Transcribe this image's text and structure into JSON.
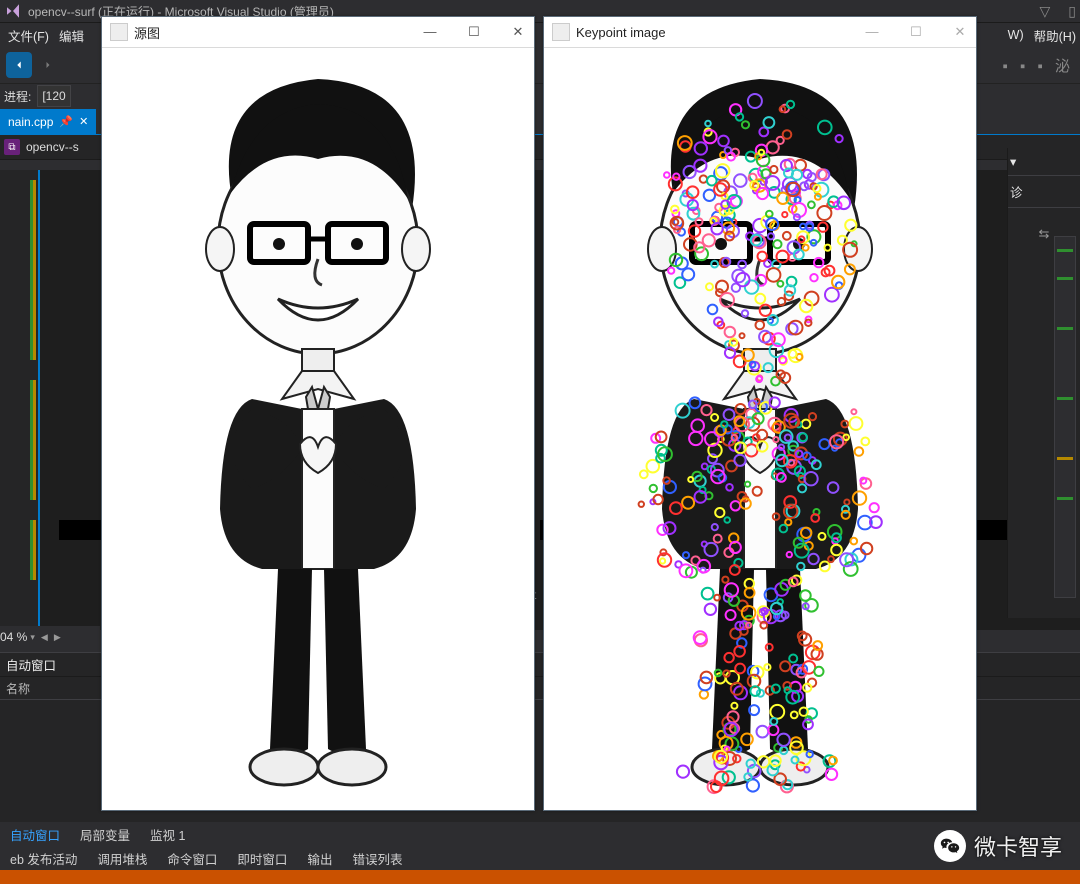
{
  "titlebar": {
    "text": "opencv--surf (正在运行) - Microsoft Visual Studio (管理员)"
  },
  "menus": {
    "file": "文件(F)",
    "edit": "编辑",
    "help": "帮助(H)",
    "w_hotkey": "W)"
  },
  "process": {
    "label": "进程:",
    "value": "[120"
  },
  "tab": {
    "filename": "nain.cpp"
  },
  "solution_item": "opencv--s",
  "right_panel": {
    "tab_diag": "诊"
  },
  "zoom": {
    "value": "04 %"
  },
  "autos": {
    "title": "自动窗口",
    "col_name": "名称"
  },
  "bottom_tabs": {
    "autos": "自动窗口",
    "locals": "局部变量",
    "watch": "监视 1"
  },
  "bottom_tabs2": {
    "publish": "eb 发布活动",
    "callstack": "调用堆栈",
    "cmd": "命令窗口",
    "immediate": "即时窗口",
    "output": "输出",
    "errors": "错误列表"
  },
  "cv_window1": {
    "title": "源图"
  },
  "cv_window2": {
    "title": "Keypoint image"
  },
  "watermark": {
    "text": "微卡智享"
  }
}
